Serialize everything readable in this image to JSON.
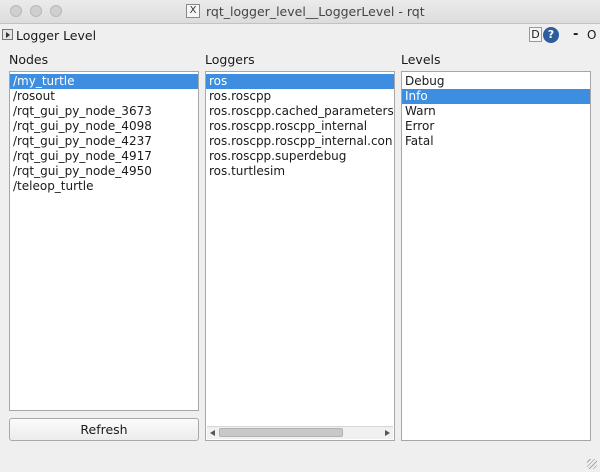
{
  "window": {
    "title": "rqt_logger_level__LoggerLevel - rqt",
    "app_icon": "x-window-icon"
  },
  "plugin": {
    "title": "Logger Level",
    "d_label": "D",
    "help_label": "?",
    "min_label": "-",
    "close_label": "O"
  },
  "nodes": {
    "label": "Nodes",
    "items": [
      "/my_turtle",
      "/rosout",
      "/rqt_gui_py_node_3673",
      "/rqt_gui_py_node_4098",
      "/rqt_gui_py_node_4237",
      "/rqt_gui_py_node_4917",
      "/rqt_gui_py_node_4950",
      "/teleop_turtle"
    ],
    "selected": "/my_turtle"
  },
  "loggers": {
    "label": "Loggers",
    "items": [
      "ros",
      "ros.roscpp",
      "ros.roscpp.cached_parameters",
      "ros.roscpp.roscpp_internal",
      "ros.roscpp.roscpp_internal.con",
      "ros.roscpp.superdebug",
      "ros.turtlesim"
    ],
    "selected": "ros"
  },
  "levels": {
    "label": "Levels",
    "items": [
      "Debug",
      "Info",
      "Warn",
      "Error",
      "Fatal"
    ],
    "selected": "Info"
  },
  "refresh_label": "Refresh",
  "colors": {
    "selection": "#3d8ee0"
  }
}
